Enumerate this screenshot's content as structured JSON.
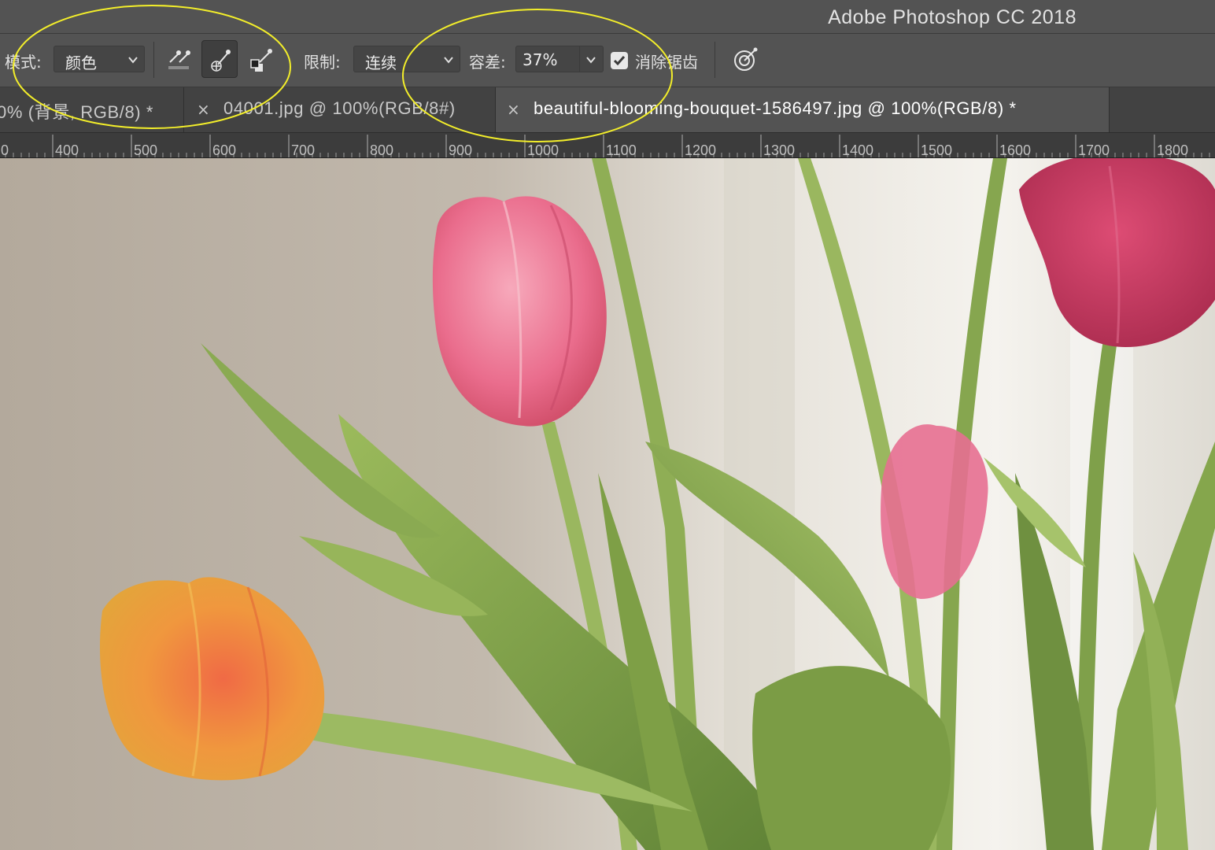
{
  "app": {
    "title": "Adobe Photoshop CC 2018"
  },
  "options": {
    "mode_label": "模式:",
    "mode_value": "颜色",
    "limit_label": "限制:",
    "limit_value": "连续",
    "tolerance_label": "容差:",
    "tolerance_value": "37%",
    "antialias_checked": true,
    "antialias_label": "消除锯齿",
    "icons": [
      "sample-eyedropper-icon",
      "add-to-sample-eyedropper-icon",
      "subtract-from-sample-eyedropper-icon",
      "protect-foreground-icon"
    ]
  },
  "tabs": [
    {
      "label": "0% (背景, RGB/8) *",
      "close": "",
      "active": false
    },
    {
      "label": "04001.jpg @ 100%(RGB/8#)",
      "close": "×",
      "active": false
    },
    {
      "label": "beautiful-blooming-bouquet-1586497.jpg @ 100%(RGB/8) *",
      "close": "×",
      "active": true
    }
  ],
  "ruler": {
    "labels": [
      "0",
      "400",
      "500",
      "600",
      "700",
      "800",
      "900",
      "1000",
      "1100",
      "1200",
      "1300",
      "1400",
      "1500",
      "1600",
      "1700",
      "1800"
    ]
  },
  "colors": {
    "annotation": "#f3ee2a",
    "tulip_pink": "#e56a88",
    "tulip_orange": "#ee9a45",
    "leaf_green": "#7d9e48",
    "background_wall": "#b7ad9f"
  }
}
